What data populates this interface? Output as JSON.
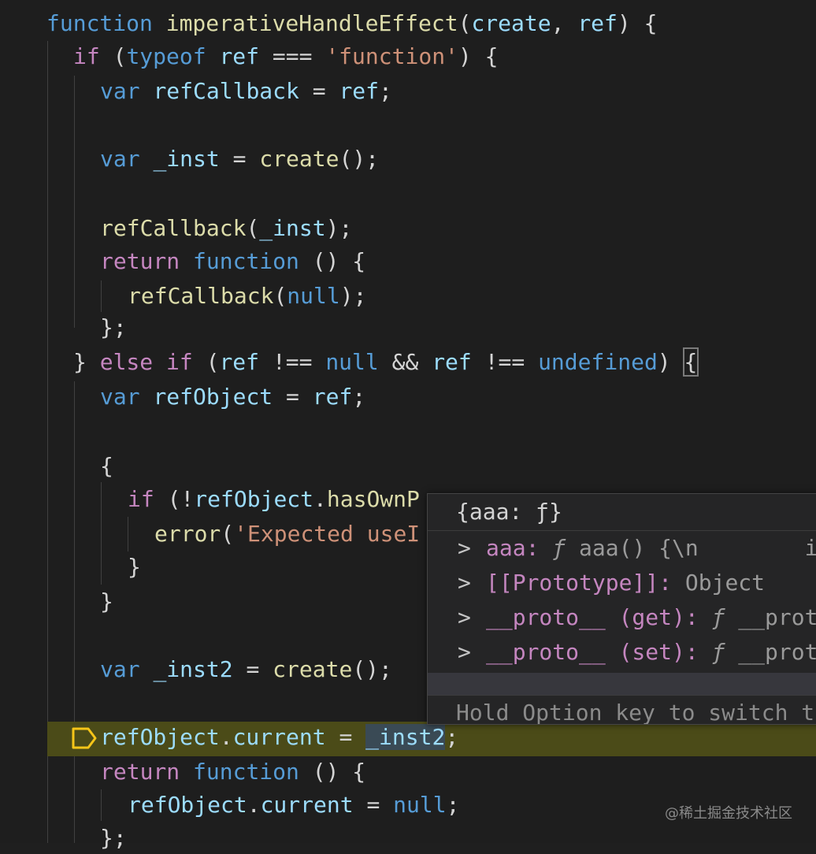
{
  "code": {
    "l1": {
      "kw": "function",
      "name": "imperativeHandleEffect",
      "p1": "(",
      "a1": "create",
      "c1": ", ",
      "a2": "ref",
      "p2": ") {"
    },
    "l2": {
      "kw": "if",
      "p1": " (",
      "t": "typeof",
      "sp": " ",
      "v": "ref",
      "op": " === ",
      "s": "'function'",
      "p2": ") {"
    },
    "l3": {
      "kw": "var",
      "sp": " ",
      "v": "refCallback",
      "op": " = ",
      "v2": "ref",
      "p": ";"
    },
    "l4": {
      "kw": "var",
      "sp": " ",
      "v": "_inst",
      "op": " = ",
      "f": "create",
      "p": "();"
    },
    "l5": {
      "f": "refCallback",
      "p1": "(",
      "v": "_inst",
      "p2": ");"
    },
    "l6": {
      "kw": "return",
      "sp": " ",
      "k2": "function",
      "p": " () {"
    },
    "l7": {
      "f": "refCallback",
      "p1": "(",
      "k": "null",
      "p2": ");"
    },
    "l8": {
      "p": "};"
    },
    "l9": {
      "p1": "} ",
      "kw": "else",
      "sp": " ",
      "kw2": "if",
      "p2": " (",
      "v": "ref",
      "op": " !== ",
      "k": "null",
      "op2": " && ",
      "v2": "ref",
      "op3": " !== ",
      "k2": "undefined",
      "p3": ") ",
      "br": "{"
    },
    "l10": {
      "kw": "var",
      "sp": " ",
      "v": "refObject",
      "op": " = ",
      "v2": "ref",
      "p": ";"
    },
    "l11": {
      "p": "{"
    },
    "l12": {
      "kw": "if",
      "p1": " (!",
      "v": "refObject",
      "p2": ".",
      "f": "hasOwnP"
    },
    "l13": {
      "f": "error",
      "p": "(",
      "s": "'Expected useI"
    },
    "l14": {
      "p": "}"
    },
    "l15": {
      "p": "}"
    },
    "l16": {
      "kw": "var",
      "sp": " ",
      "v": "_inst2",
      "op": " = ",
      "f": "create",
      "p": "();"
    },
    "l17": {
      "v": "refObject",
      "p": ".",
      "v2": "current",
      "op": " = ",
      "v3": "_inst2",
      "p2": ";"
    },
    "l18": {
      "kw": "return",
      "sp": " ",
      "k2": "function",
      "p": " () {"
    },
    "l19": {
      "v": "refObject",
      "p": ".",
      "v2": "current",
      "op": " = ",
      "k": "null",
      "p2": ";"
    },
    "l20": {
      "p": "};"
    }
  },
  "hover": {
    "header": "{aaa: ƒ}",
    "rows": [
      {
        "chev": ">",
        "name": "aaa",
        "sep": ": ",
        "f": "ƒ",
        "rest": " aaa() {\\n        inp"
      },
      {
        "chev": ">",
        "name": "[[Prototype]]",
        "sep": ": ",
        "rest": "Object"
      },
      {
        "chev": ">",
        "name": "__proto__ (get)",
        "sep": ": ",
        "f": "ƒ",
        "rest": " __proto_"
      },
      {
        "chev": ">",
        "name": "__proto__ (set)",
        "sep": ": ",
        "f": "ƒ",
        "rest": " __proto_"
      }
    ],
    "footer": "Hold Option key to switch to"
  },
  "watermark": "@稀土掘金技术社区",
  "colors": {
    "keyword": "#569cd6",
    "control": "#c586c0",
    "function": "#dcdcaa",
    "variable": "#9cdcfe",
    "string": "#ce9178",
    "highlight": "#4b4b18",
    "breakpoint": "#f5c518"
  }
}
